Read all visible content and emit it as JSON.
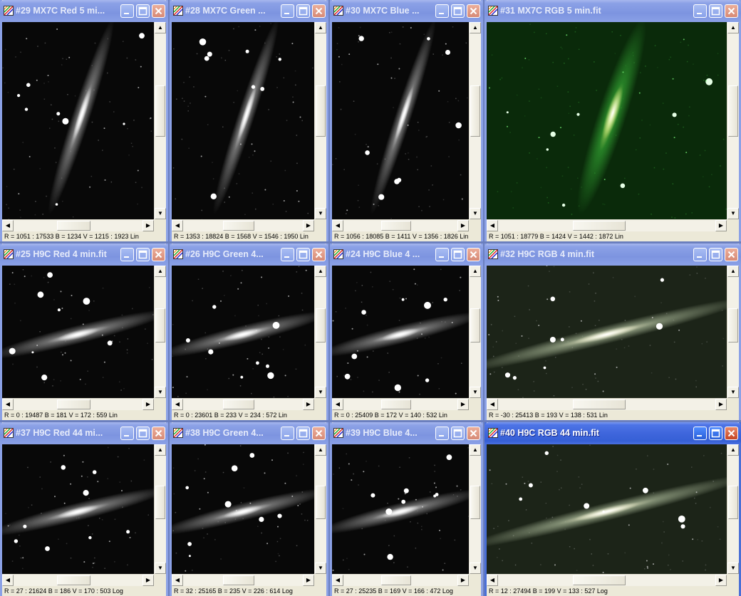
{
  "windows": [
    {
      "id": "w29",
      "title": "#29 MX7C Red 5 mi...",
      "status": "R = 1051 : 17533    B = 1234    V = 1215 : 1923 Lin",
      "tint": "mono",
      "active": false
    },
    {
      "id": "w28",
      "title": "#28 MX7C Green ...",
      "status": "R = 1353 : 18824    B = 1568    V = 1546 : 1950 Lin",
      "tint": "mono",
      "active": false
    },
    {
      "id": "w30",
      "title": "#30 MX7C Blue ...",
      "status": "R = 1056 : 18085    B = 1411    V = 1356 : 1826 Lin",
      "tint": "mono",
      "active": false
    },
    {
      "id": "w31",
      "title": "#31 MX7C RGB 5 min.fit",
      "status": "R = 1051 : 18779    B = 1424    V = 1442 : 1872 Lin",
      "tint": "green",
      "active": false
    },
    {
      "id": "w25",
      "title": "#25 H9C Red 4 min.fit",
      "status": "R = 0 : 19487    B = 181    V = 172 : 559 Lin",
      "tint": "mono",
      "active": false
    },
    {
      "id": "w26",
      "title": "#26 H9C Green 4...",
      "status": "R = 0 : 23601    B = 233    V = 234 : 572 Lin",
      "tint": "mono",
      "active": false
    },
    {
      "id": "w24",
      "title": "#24 H9C Blue 4 ...",
      "status": "R = 0 : 25409    B = 172    V = 140 : 532 Lin",
      "tint": "mono",
      "active": false
    },
    {
      "id": "w32",
      "title": "#32 H9C RGB 4 min.fit",
      "status": "R = -30 : 25413    B = 193    V = 138 : 531 Lin",
      "tint": "color",
      "active": false
    },
    {
      "id": "w37",
      "title": "#37 H9C Red 44 mi...",
      "status": "R = 27 : 21624    B = 186    V = 170 : 503 Log",
      "tint": "mono",
      "active": false
    },
    {
      "id": "w38",
      "title": "#38 H9C Green 4...",
      "status": "R = 32 : 25165    B = 235    V = 226 : 614 Log",
      "tint": "mono",
      "active": false
    },
    {
      "id": "w39",
      "title": "#39 H9C Blue 4...",
      "status": "R = 27 : 25235    B = 169    V = 166 : 472 Log",
      "tint": "mono",
      "active": false
    },
    {
      "id": "w40",
      "title": "#40 H9C RGB 44 min.fit",
      "status": "R = 12 : 27494    B = 199    V = 133 : 527 Log",
      "tint": "color",
      "active": true
    }
  ],
  "icons": {
    "window": "image-window-icon",
    "minimize": "minimize-icon",
    "maximize": "maximize-icon",
    "close": "close-icon",
    "scroll_up": "arrow-up-icon",
    "scroll_down": "arrow-down-icon",
    "scroll_left": "arrow-left-icon",
    "scroll_right": "arrow-right-icon"
  },
  "colors": {
    "title_active": "#3f66dc",
    "title_inactive": "#7d94e0",
    "close_button": "#c54524",
    "desktop": "#6b7fbe"
  }
}
